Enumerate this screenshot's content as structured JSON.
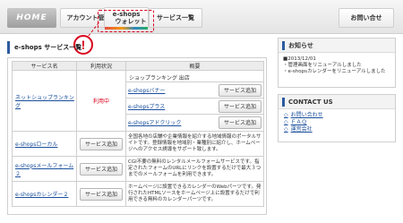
{
  "nav": {
    "home": "HOME",
    "account": "アカウント管",
    "wallet_line1": "e-shops",
    "wallet_line2": "ウォレット",
    "service_list": "サービス一覧",
    "contact": "お問い合せ"
  },
  "alert_mark": "!",
  "main": {
    "title": "e-shops  サービス一覧",
    "columns": [
      "サービス名",
      "利用状況",
      "概要"
    ],
    "row1": {
      "name": "ネットショップランキング",
      "status": "利用中",
      "summary": "ショップランキング 出店",
      "subs": [
        {
          "name": "e-shopsバナー",
          "button": "サービス追加"
        },
        {
          "name": "e-shopsプラス",
          "button": "サービス追加"
        },
        {
          "name": "e-shopsアドクリック",
          "button": "サービス追加"
        }
      ]
    },
    "row2": {
      "name": "e-shopsローカル",
      "button": "サービス追加",
      "desc": "全国各地の店舗や企業情報を紹介する地域情報のポータルサイトです。登録情報を地域別・業種別に紹介し、ホームページへのアクセス誘導をサポート致します。"
    },
    "row3": {
      "name": "e-shopsメールフォーム２",
      "button": "サービス追加",
      "desc": "CGI不要の無料のレンタルメールフォームサービスです。指定されたフォームのURLにリンクを設置するだけで最大３つまでのメールフォームを利用できます。"
    },
    "row4": {
      "name": "e-shopsカレンダー２",
      "button": "サービス追加",
      "desc": "ホームページに設置できるカレンダーのWebパーツです。発行されたHTMLソースをホームページ上に設置するだけで利用できる無料のカレンダーパーツです。"
    }
  },
  "sidebar": {
    "news_title": "お知らせ",
    "news_date": "■2013/12/01",
    "news_line1": "・管理画面をリニューアルしました",
    "news_line2": "・e-shopsカレンダーをリニューアルしました",
    "contact_title": "CONTACT US",
    "contact_links": [
      "お問い合わせ",
      "ＦＡＱ",
      "運営会社"
    ]
  },
  "colors": {
    "accent_blue": "#2c5aa0",
    "alert_red": "#d9001b"
  }
}
